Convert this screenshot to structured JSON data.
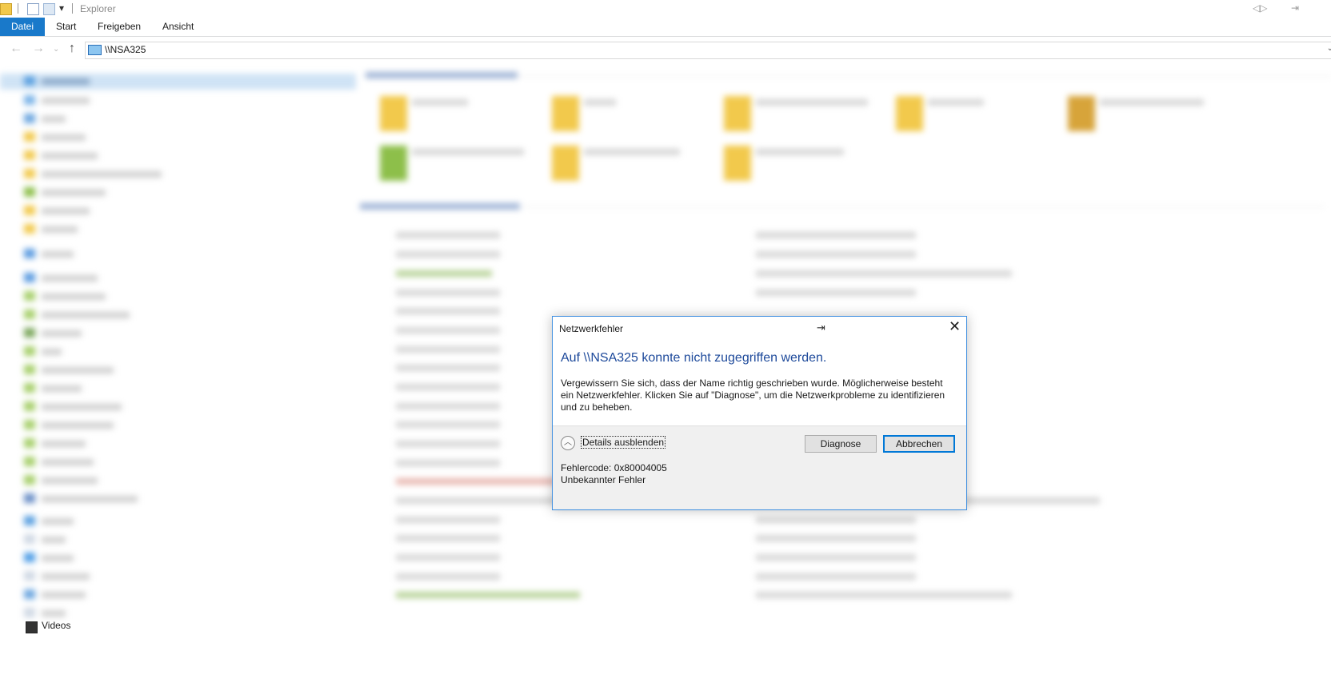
{
  "window": {
    "title": "Explorer"
  },
  "ribbon": {
    "tabs": [
      {
        "label": "Datei",
        "active": true
      },
      {
        "label": "Start",
        "active": false
      },
      {
        "label": "Freigeben",
        "active": false
      },
      {
        "label": "Ansicht",
        "active": false
      }
    ]
  },
  "address_bar": {
    "path": "\\\\NSA325"
  },
  "nav_pane": {
    "visible_item": "Videos"
  },
  "dialog": {
    "title": "Netzwerkfehler",
    "heading": "Auf \\\\NSA325 konnte nicht zugegriffen werden.",
    "message": "Vergewissern Sie sich, dass der Name richtig geschrieben wurde. Möglicherweise besteht ein Netzwerkfehler. Klicken Sie auf \"Diagnose\", um die Netzwerkprobleme zu identifizieren und zu beheben.",
    "details_toggle": "Details ausblenden",
    "buttons": {
      "diagnose": "Diagnose",
      "cancel": "Abbrechen"
    },
    "details": {
      "error_code": "Fehlercode: 0x80004005",
      "error_text": "Unbekannter Fehler"
    }
  },
  "colors": {
    "accent": "#1979ca",
    "dialog_heading": "#1e4a9b",
    "dialog_border": "#3d8ee0"
  }
}
